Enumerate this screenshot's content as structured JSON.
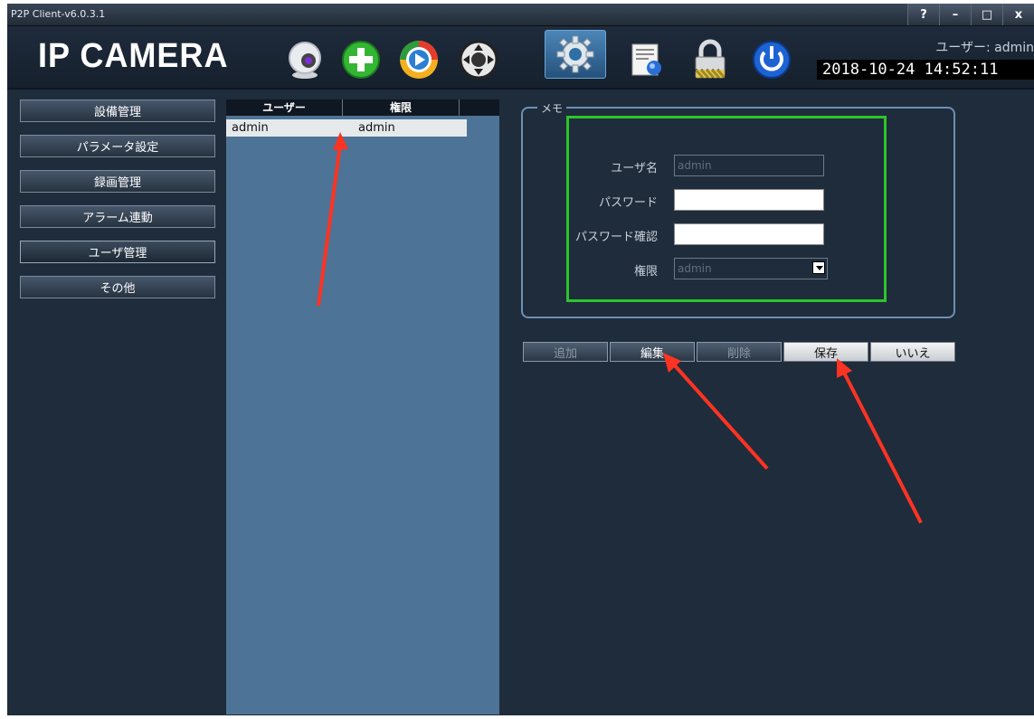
{
  "window": {
    "title": "P2P Client-v6.0.3.1",
    "help": "?",
    "minimize": "–",
    "maximize": "□",
    "close": "x"
  },
  "header": {
    "logo": "IP CAMERA",
    "user_label": "ユーザー: admin",
    "datetime": "2018-10-24 14:52:11",
    "toolbar": [
      "camera-icon",
      "add-device-icon",
      "playback-icon",
      "ptz-control-icon",
      "settings-icon",
      "log-icon",
      "lock-icon",
      "power-icon"
    ],
    "active_tool": "settings-icon"
  },
  "sidebar": {
    "items": [
      {
        "label": "設備管理"
      },
      {
        "label": "パラメータ設定"
      },
      {
        "label": "録画管理"
      },
      {
        "label": "アラーム連動"
      },
      {
        "label": "ユーザ管理"
      },
      {
        "label": "その他"
      }
    ],
    "active_index": 4
  },
  "user_list": {
    "columns": [
      "ユーザー",
      "権限"
    ],
    "rows": [
      {
        "user": "admin",
        "role": "admin"
      }
    ]
  },
  "memo": {
    "legend": "メモ",
    "username_label": "ユーザ名",
    "username_value": "admin",
    "password_label": "パスワード",
    "password_value": "",
    "confirm_label": "パスワード確認",
    "confirm_value": "",
    "role_label": "権限",
    "role_value": "admin"
  },
  "actions": {
    "add": "追加",
    "edit": "編集",
    "delete": "削除",
    "save": "保存",
    "cancel": "いいえ"
  },
  "colors": {
    "background": "#1f2c3b",
    "list_panel": "#4d7396",
    "highlight_box": "#2cc52c",
    "annotation_arrow": "#ff3322"
  }
}
